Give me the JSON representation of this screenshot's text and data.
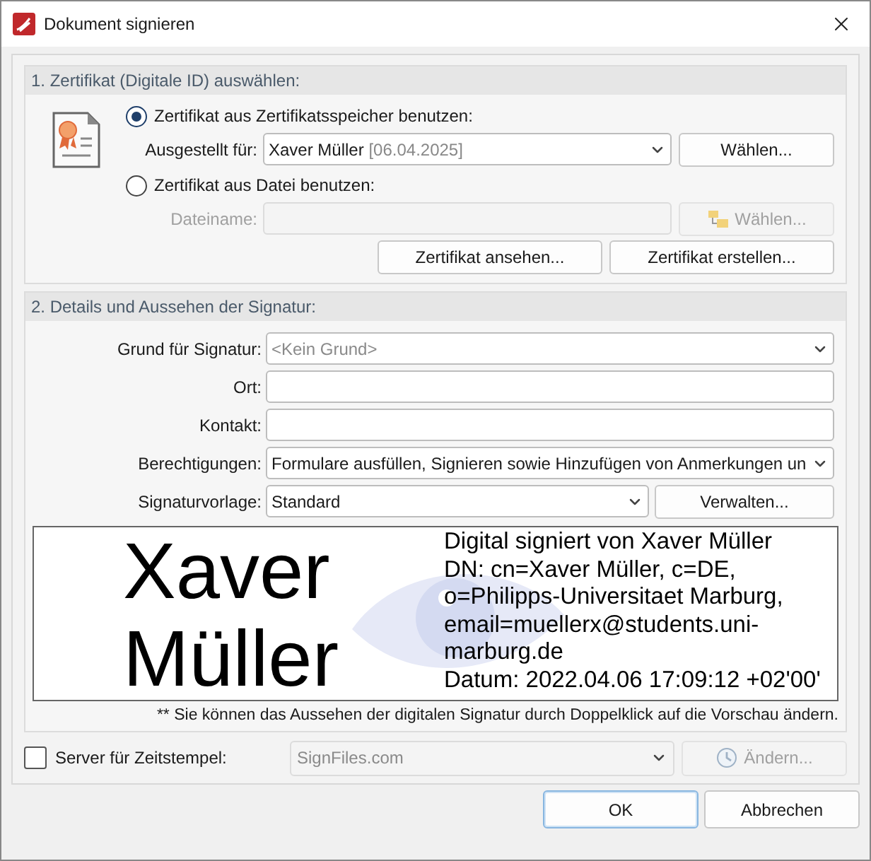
{
  "window": {
    "title": "Dokument signieren"
  },
  "certificate_section": {
    "title": "1. Zertifikat (Digitale ID) auswählen:",
    "sources": [
      {
        "label": "Zertifikat aus Zertifikatsspeicher benutzen:",
        "selected": true,
        "field_label": "Ausgestellt für:",
        "value": "Xaver Müller",
        "value_detail": "[06.04.2025]",
        "button": "Wählen...",
        "disabled": false
      },
      {
        "label": "Zertifikat aus Datei benutzen:",
        "selected": false,
        "field_label": "Dateiname:",
        "button": "Wählen...",
        "disabled": true
      }
    ],
    "buttons": [
      "Zertifikat ansehen...",
      "Zertifikat erstellen..."
    ]
  },
  "details_section": {
    "title": "2. Details und Aussehen der Signatur:",
    "fields": [
      {
        "kind": "dropdown",
        "label": "Grund für Signatur:",
        "placeholder": "<Kein Grund>"
      },
      {
        "kind": "text",
        "label": "Ort:"
      },
      {
        "kind": "text",
        "label": "Kontakt:"
      },
      {
        "kind": "dropdown",
        "label": "Berechtigungen:",
        "value": "Formulare ausfüllen, Signieren sowie Hinzufügen von Anmerkungen un"
      },
      {
        "kind": "dropdown_button",
        "label": "Signaturvorlage:",
        "value": "Standard",
        "button": "Verwalten..."
      }
    ],
    "preview": {
      "name_lines": [
        "Xaver",
        "Müller"
      ],
      "details": [
        "Digital signiert von Xaver Müller",
        "DN: cn=Xaver Müller, c=DE,",
        "o=Philipps-Universitaet Marburg,",
        "email=muellerx@students.uni-",
        "marburg.de",
        "Datum: 2022.04.06 17:09:12 +02'00'"
      ]
    },
    "note": "** Sie können das Aussehen der digitalen Signatur durch Doppelklick auf die Vorschau ändern."
  },
  "timestamp": {
    "label": "Server für Zeitstempel:",
    "checked": false,
    "value": "SignFiles.com",
    "button": "Ändern...",
    "disabled": true
  },
  "buttons": [
    {
      "label": "OK",
      "default": true
    },
    {
      "label": "Abbrechen",
      "default": false
    }
  ]
}
